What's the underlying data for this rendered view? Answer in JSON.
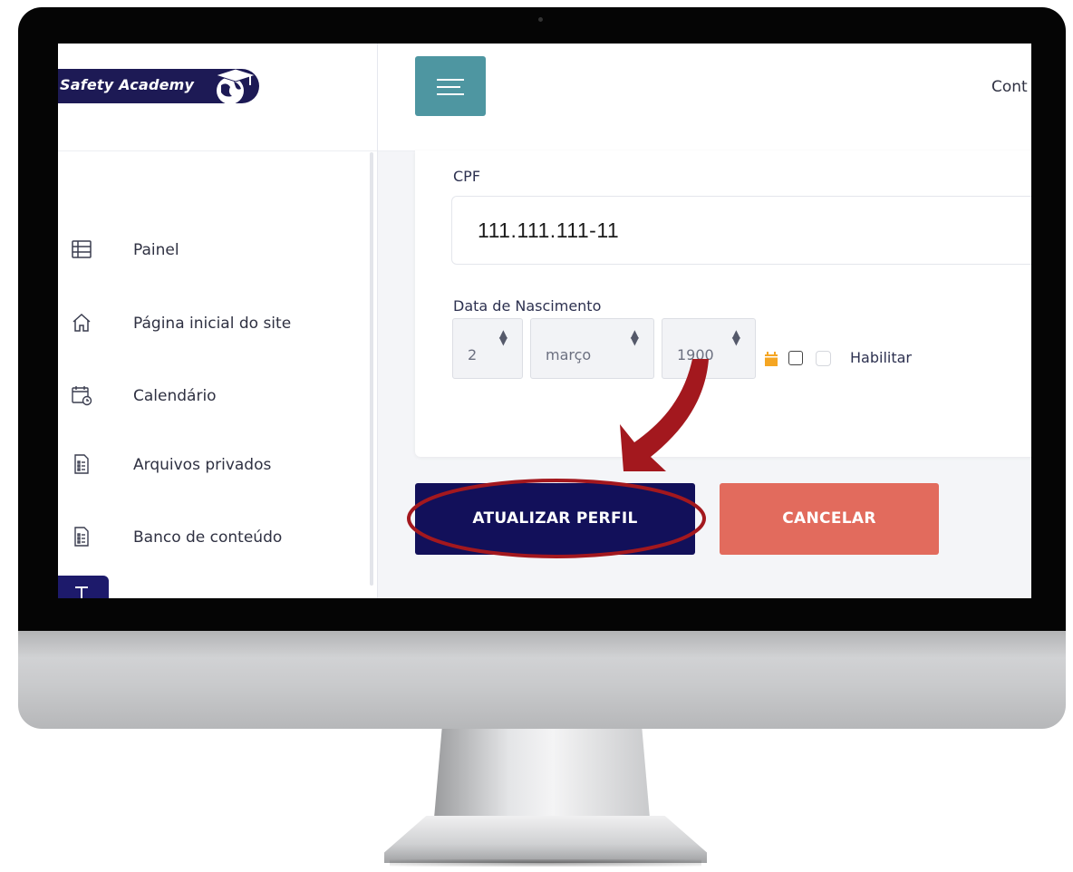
{
  "brand": {
    "logo_text": "Safety Academy"
  },
  "header": {
    "menu_icon": "hamburger-icon",
    "top_link": "Cont"
  },
  "sidebar": {
    "items": [
      {
        "label": "Painel",
        "icon": "table-icon"
      },
      {
        "label": "Página inicial do site",
        "icon": "home-icon"
      },
      {
        "label": "Calendário",
        "icon": "calendar-icon"
      },
      {
        "label": "Arquivos privados",
        "icon": "file-icon"
      },
      {
        "label": "Banco de conteúdo",
        "icon": "file-icon"
      }
    ]
  },
  "form": {
    "cpf_label": "CPF",
    "cpf_value": "111.111.111-11",
    "birth_label": "Data de Nascimento",
    "day": "2",
    "month": "março",
    "year": "1900",
    "enable_label": "Habilitar"
  },
  "actions": {
    "update_label": "ATUALIZAR PERFIL",
    "cancel_label": "CANCELAR"
  },
  "colors": {
    "menu_button": "#4e96a1",
    "update_button": "#12105a",
    "cancel_button": "#e26b5d",
    "annotation": "#a3181e",
    "calendar_icon": "#f5a623"
  }
}
